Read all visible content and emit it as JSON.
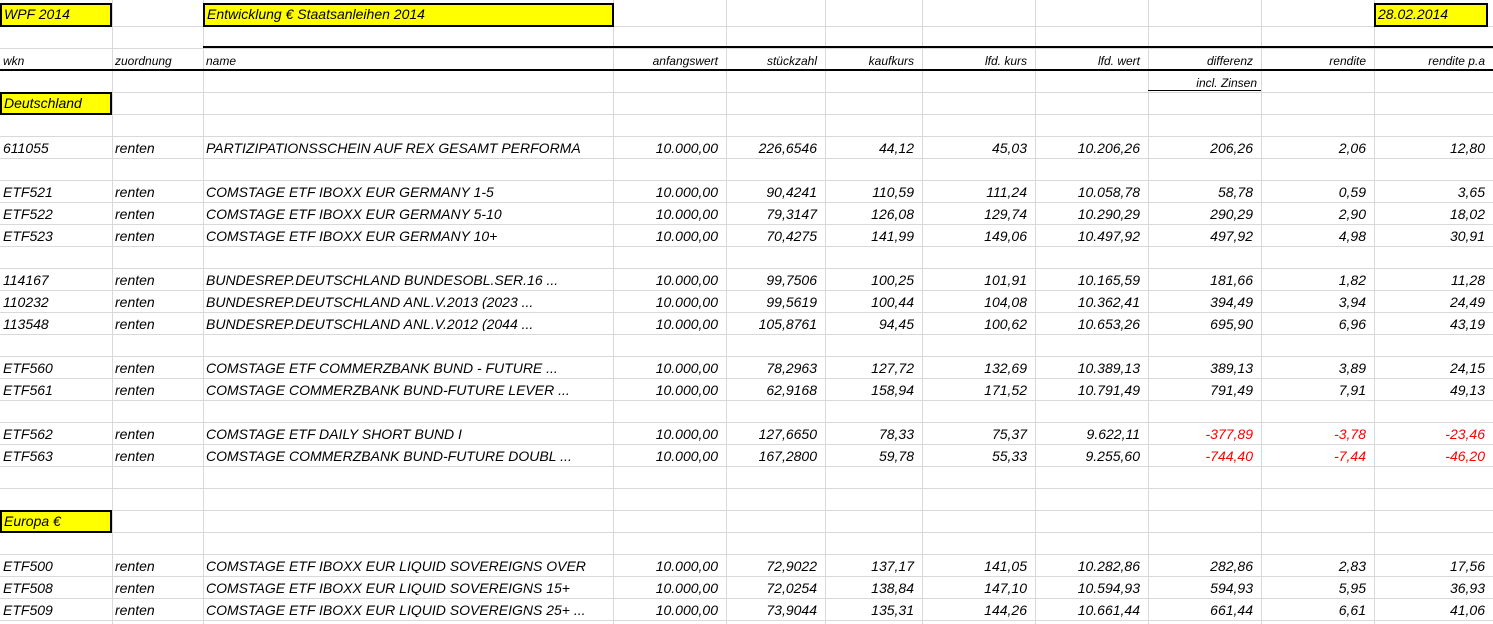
{
  "title_box": "WPF 2014",
  "subtitle_box": "Entwicklung € Staatsanleihen 2014",
  "date_box": "28.02.2014",
  "headers": {
    "wkn": "wkn",
    "zuordnung": "zuordnung",
    "name": "name",
    "anfangswert": "anfangswert",
    "stueckzahl": "stückzahl",
    "kaufkurs": "kaufkurs",
    "lfd_kurs": "lfd. kurs",
    "lfd_wert": "lfd. wert",
    "differenz": "differenz",
    "rendite": "rendite",
    "rendite_pa": "rendite p.a"
  },
  "differenz_note": "incl. Zinsen",
  "sections": [
    {
      "label": "Deutschland",
      "rows": [
        [
          "611055",
          "renten",
          "PARTIZIPATIONSSCHEIN AUF REX GESAMT PERFORMA",
          "10.000,00",
          "226,6546",
          "44,12",
          "45,03",
          "10.206,26",
          "206,26",
          "2,06",
          "12,80"
        ],
        [
          "ETF521",
          "renten",
          "COMSTAGE ETF IBOXX EUR GERMANY 1-5",
          "10.000,00",
          "90,4241",
          "110,59",
          "111,24",
          "10.058,78",
          "58,78",
          "0,59",
          "3,65"
        ],
        [
          "ETF522",
          "renten",
          "COMSTAGE ETF IBOXX EUR GERMANY 5-10",
          "10.000,00",
          "79,3147",
          "126,08",
          "129,74",
          "10.290,29",
          "290,29",
          "2,90",
          "18,02"
        ],
        [
          "ETF523",
          "renten",
          "COMSTAGE ETF IBOXX EUR GERMANY 10+",
          "10.000,00",
          "70,4275",
          "141,99",
          "149,06",
          "10.497,92",
          "497,92",
          "4,98",
          "30,91"
        ],
        [
          "114167",
          "renten",
          "BUNDESREP.DEUTSCHLAND BUNDESOBL.SER.16 ...",
          "10.000,00",
          "99,7506",
          "100,25",
          "101,91",
          "10.165,59",
          "181,66",
          "1,82",
          "11,28"
        ],
        [
          "110232",
          "renten",
          "BUNDESREP.DEUTSCHLAND ANL.V.2013 (2023 ...",
          "10.000,00",
          "99,5619",
          "100,44",
          "104,08",
          "10.362,41",
          "394,49",
          "3,94",
          "24,49"
        ],
        [
          "113548",
          "renten",
          "BUNDESREP.DEUTSCHLAND ANL.V.2012 (2044 ...",
          "10.000,00",
          "105,8761",
          "94,45",
          "100,62",
          "10.653,26",
          "695,90",
          "6,96",
          "43,19"
        ],
        [
          "ETF560",
          "renten",
          "COMSTAGE ETF COMMERZBANK BUND - FUTURE ...",
          "10.000,00",
          "78,2963",
          "127,72",
          "132,69",
          "10.389,13",
          "389,13",
          "3,89",
          "24,15"
        ],
        [
          "ETF561",
          "renten",
          "COMSTAGE COMMERZBANK BUND-FUTURE LEVER ...",
          "10.000,00",
          "62,9168",
          "158,94",
          "171,52",
          "10.791,49",
          "791,49",
          "7,91",
          "49,13"
        ],
        [
          "ETF562",
          "renten",
          "COMSTAGE ETF DAILY SHORT BUND I",
          "10.000,00",
          "127,6650",
          "78,33",
          "75,37",
          "9.622,11",
          "-377,89",
          "-3,78",
          "-23,46"
        ],
        [
          "ETF563",
          "renten",
          "COMSTAGE COMMERZBANK BUND-FUTURE DOUBL ...",
          "10.000,00",
          "167,2800",
          "59,78",
          "55,33",
          "9.255,60",
          "-744,40",
          "-7,44",
          "-46,20"
        ]
      ]
    },
    {
      "label": "Europa €",
      "rows": [
        [
          "ETF500",
          "renten",
          "COMSTAGE ETF IBOXX EUR LIQUID SOVEREIGNS OVER",
          "10.000,00",
          "72,9022",
          "137,17",
          "141,05",
          "10.282,86",
          "282,86",
          "2,83",
          "17,56"
        ],
        [
          "ETF508",
          "renten",
          "COMSTAGE ETF IBOXX EUR LIQUID SOVEREIGNS 15+",
          "10.000,00",
          "72,0254",
          "138,84",
          "147,10",
          "10.594,93",
          "594,93",
          "5,95",
          "36,93"
        ],
        [
          "ETF509",
          "renten",
          "COMSTAGE ETF IBOXX EUR LIQUID SOVEREIGNS 25+ ...",
          "10.000,00",
          "73,9044",
          "135,31",
          "144,26",
          "10.661,44",
          "661,44",
          "6,61",
          "41,06"
        ]
      ]
    }
  ],
  "colors": {
    "highlight": "#ffff00",
    "negative": "#ff0000",
    "grid": "#d9d9d9"
  }
}
